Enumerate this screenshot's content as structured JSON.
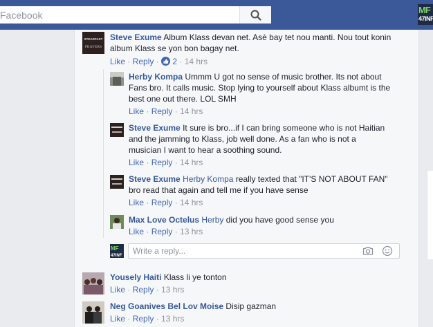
{
  "topbar": {
    "search_placeholder": "Facebook",
    "logo_text_top": "MF",
    "logo_text_bottom": "47INF"
  },
  "comments": [
    {
      "author": "Steve Exume",
      "text": "Album Klass devan net. Asè bay tet nou manti. Nou tout konin",
      "text_line2": "album Klass se yon bon bagay net.",
      "like": "Like",
      "reply": "Reply",
      "like_count": "2",
      "time": "14 hrs",
      "avatar_text": [
        "STEADFAST",
        "PRAYERS"
      ]
    },
    {
      "author": "Herby Kompa",
      "text": "Ummm U got no sense of music brother. Its not about",
      "text_line2": "Fans bro. It calls music. Stop lying to yourself about Klass albumt is the",
      "text_line3": "best one out there. LOL SMH",
      "like": "Like",
      "reply": "Reply",
      "time": "14 hrs"
    },
    {
      "author": "Steve Exume",
      "text": "It sure is bro...if I can bring someone who is not Haitian",
      "text_line2": "and the jamming to Klass, job well done. As a fan who is not a",
      "text_line3": "musician I want to hear a soothing sound.",
      "like": "Like",
      "reply": "Reply",
      "time": "14 hrs"
    },
    {
      "author": "Steve Exume",
      "tag": "Herby Kompa",
      "text": "really texted that \"IT'S NOT ABOUT FAN\"",
      "text_line2": "bro read that again and tell me if you have sense",
      "like": "Like",
      "reply": "Reply",
      "time": "14 hrs"
    },
    {
      "author": "Max Love Octelus",
      "tag": "Herby",
      "text": "did you have good sense you",
      "like": "Like",
      "reply": "Reply",
      "time": "13 hrs"
    },
    {
      "author": "Yousely Haiti",
      "text": "Klass li ye tonton",
      "like": "Like",
      "reply": "Reply",
      "time": "13 hrs"
    },
    {
      "author": "Neg Goanives Bel Lov Moise",
      "text": "Disip gazman",
      "like": "Like",
      "reply": "Reply",
      "time": "13 hrs"
    }
  ],
  "reply_box": {
    "placeholder": "Write a reply...",
    "avatar_top": "MF",
    "avatar_bottom": "47INF"
  },
  "colors": {
    "brand": "#3b5998",
    "link": "#365899",
    "action_link": "#4267b2",
    "meta": "#90949c"
  }
}
